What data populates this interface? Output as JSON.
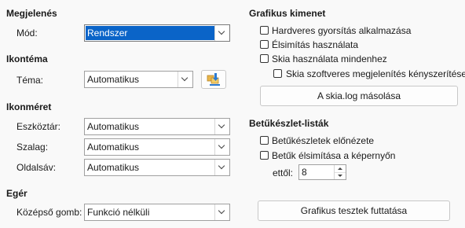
{
  "appearance": {
    "heading": "Megjelenés",
    "mode_label": "Mód:",
    "mode_value": "Rendszer"
  },
  "icon_theme": {
    "heading": "Ikontéma",
    "theme_label": "Téma:",
    "theme_value": "Automatikus",
    "extension_icon": "install-extension-icon"
  },
  "icon_size": {
    "heading": "Ikonméret",
    "toolbar_label": "Eszköztár:",
    "toolbar_value": "Automatikus",
    "ribbon_label": "Szalag:",
    "ribbon_value": "Automatikus",
    "sidebar_label": "Oldalsáv:",
    "sidebar_value": "Automatikus"
  },
  "mouse": {
    "heading": "Egér",
    "middle_label": "Középső gomb:",
    "middle_value": "Funkció nélküli"
  },
  "graphics_output": {
    "heading": "Grafikus kimenet",
    "hw_accel": "Hardveres gyorsítás alkalmazása",
    "antialias": "Élsimítás használata",
    "skia_always": "Skia használata mindenhez",
    "skia_software": "Skia szoftveres megjelenítés kényszerítése",
    "copy_skia_log": "A skia.log másolása"
  },
  "font_lists": {
    "heading": "Betűkészlet-listák",
    "preview": "Betűkészletek előnézete",
    "screen_antialias": "Betűk élsimítása a képernyőn",
    "from_label": "ettől:",
    "from_value": "8",
    "run_tests": "Grafikus tesztek futtatása"
  },
  "colors": {
    "selection": "#0a64c8",
    "background": "#f9f9f9"
  }
}
